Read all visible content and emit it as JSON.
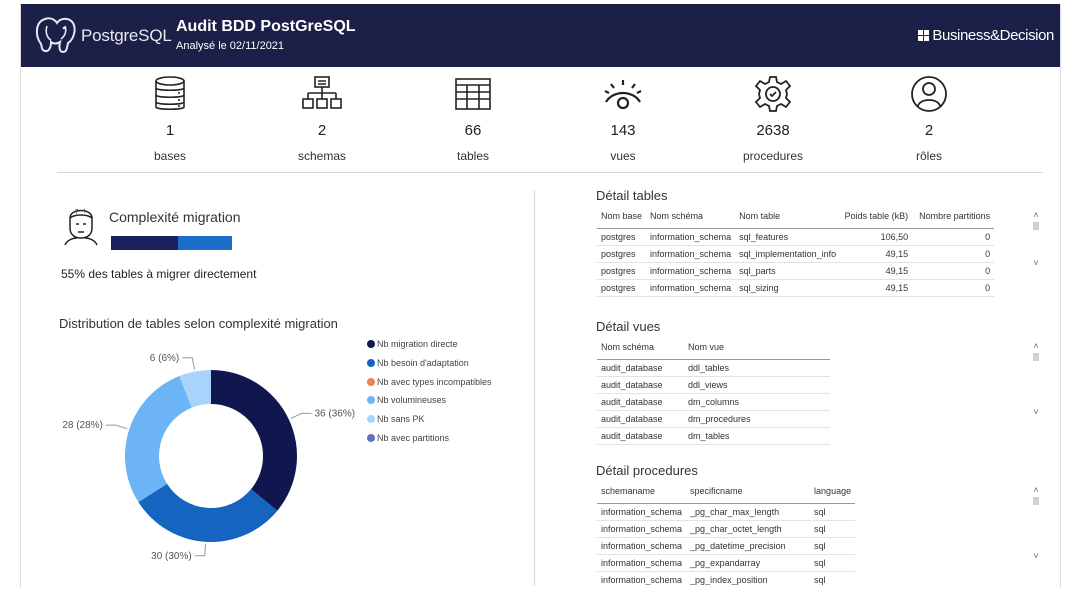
{
  "header": {
    "brand": "PostgreSQL",
    "title": "Audit BDD PostGreSQL",
    "subtitle": "Analysé le  02/11/2021",
    "partner": "Business&Decision"
  },
  "kpis": [
    {
      "icon": "database-icon",
      "value": "1",
      "label": "bases"
    },
    {
      "icon": "hierarchy-icon",
      "value": "2",
      "label": "schemas"
    },
    {
      "icon": "table-icon",
      "value": "66",
      "label": "tables"
    },
    {
      "icon": "eye-icon",
      "value": "143",
      "label": "vues"
    },
    {
      "icon": "gear-icon",
      "value": "2638",
      "label": "procedures"
    },
    {
      "icon": "user-icon",
      "value": "2",
      "label": "rôles"
    }
  ],
  "complexity": {
    "title": "Complexité migration",
    "share_direct": 0.55,
    "bar_colors": [
      "#1a1f5e",
      "#1c6dc8"
    ],
    "text": "55% des tables à migrer directement"
  },
  "chart_data": {
    "type": "donut",
    "title": "Distribution de tables selon complexité migration",
    "series": [
      {
        "name": "Nb migration directe",
        "value": 36,
        "label": "36 (36%)",
        "color": "#10174f"
      },
      {
        "name": "Nb besoin d'adaptation",
        "value": 30,
        "label": "30 (30%)",
        "color": "#1565c0"
      },
      {
        "name": "Nb avec types incompatibles",
        "value": 0,
        "label": "",
        "color": "#e8835a"
      },
      {
        "name": "Nb volumineuses",
        "value": 28,
        "label": "28 (28%)",
        "color": "#6cb4f5"
      },
      {
        "name": "Nb sans PK",
        "value": 6,
        "label": "6 (6%)",
        "color": "#a9d3fb"
      },
      {
        "name": "Nb avec partitions",
        "value": 0,
        "label": "",
        "color": "#6470c4"
      }
    ],
    "legend_position": "right"
  },
  "tables_detail": {
    "title": "Détail tables",
    "columns": [
      "Nom base",
      "Nom schéma",
      "Nom table",
      "Poids table (kB)",
      "Nombre partitions"
    ],
    "rows": [
      [
        "postgres",
        "information_schema",
        "sql_features",
        "106,50",
        "0"
      ],
      [
        "postgres",
        "information_schema",
        "sql_implementation_info",
        "49,15",
        "0"
      ],
      [
        "postgres",
        "information_schema",
        "sql_parts",
        "49,15",
        "0"
      ],
      [
        "postgres",
        "information_schema",
        "sql_sizing",
        "49,15",
        "0"
      ]
    ]
  },
  "views_detail": {
    "title": "Détail vues",
    "columns": [
      "Nom schéma",
      "Nom vue"
    ],
    "rows": [
      [
        "audit_database",
        "ddl_tables"
      ],
      [
        "audit_database",
        "ddl_views"
      ],
      [
        "audit_database",
        "dm_columns"
      ],
      [
        "audit_database",
        "dm_procedures"
      ],
      [
        "audit_database",
        "dm_tables"
      ]
    ]
  },
  "procedures_detail": {
    "title": "Détail procedures",
    "columns": [
      "schemaname",
      "specificname",
      "language"
    ],
    "rows": [
      [
        "information_schema",
        "_pg_char_max_length",
        "sql"
      ],
      [
        "information_schema",
        "_pg_char_octet_length",
        "sql"
      ],
      [
        "information_schema",
        "_pg_datetime_precision",
        "sql"
      ],
      [
        "information_schema",
        "_pg_expandarray",
        "sql"
      ],
      [
        "information_schema",
        "_pg_index_position",
        "sql"
      ]
    ]
  },
  "scroll": {
    "up": "˄",
    "down": "˅"
  }
}
